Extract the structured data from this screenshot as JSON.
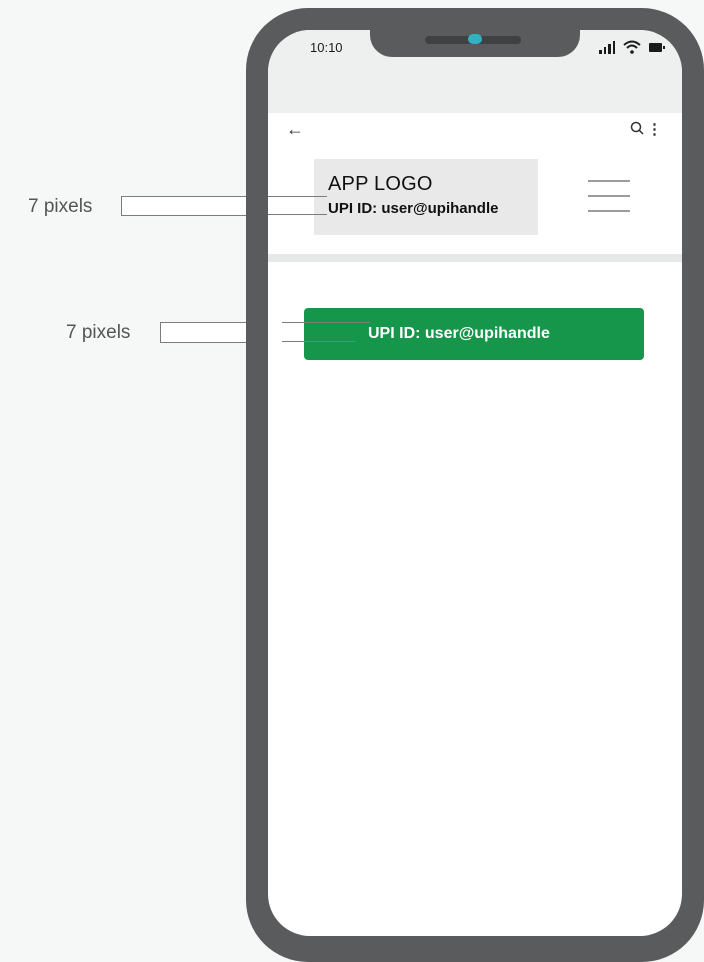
{
  "status_bar": {
    "time": "10:10"
  },
  "app_bar": {
    "back_icon": "back-arrow-icon",
    "search_icon": "search-icon",
    "more_icon": "more-vertical-icon"
  },
  "header": {
    "logo_text": "APP LOGO",
    "upi_id": "UPI ID: user@upihandle",
    "menu_icon": "hamburger-menu-icon"
  },
  "upi_banner": {
    "text": "UPI ID: user@upihandle",
    "color": "#16964a"
  },
  "annotations": [
    {
      "label": "7 pixels"
    },
    {
      "label": "7 pixels"
    }
  ],
  "colors": {
    "phone_frame": "#595b5d",
    "camera": "#2fb3c3",
    "status_bg": "#eeefef",
    "logo_box": "#e8e9e8"
  }
}
